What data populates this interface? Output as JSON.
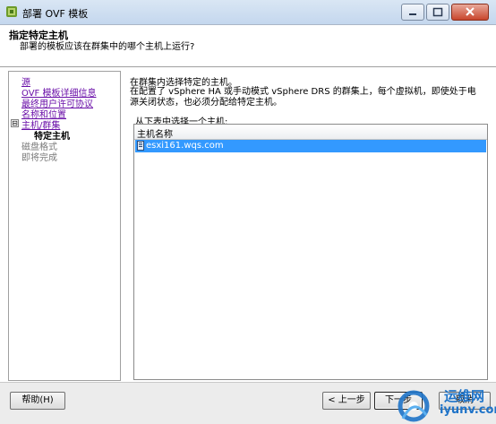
{
  "window": {
    "title": "部署 OVF 模板"
  },
  "header": {
    "title": "指定特定主机",
    "subtitle": "部署的模板应该在群集中的哪个主机上运行?"
  },
  "nav": {
    "items": [
      {
        "label": "源",
        "state": "link"
      },
      {
        "label": "OVF 模板详细信息",
        "state": "link"
      },
      {
        "label": "最终用户许可协议",
        "state": "link"
      },
      {
        "label": "名称和位置",
        "state": "link"
      },
      {
        "label": "主机/群集",
        "state": "link"
      },
      {
        "label": "特定主机",
        "state": "current"
      },
      {
        "label": "磁盘格式",
        "state": "disabled"
      },
      {
        "label": "即将完成",
        "state": "disabled"
      }
    ],
    "tree_toggle": "⊟"
  },
  "content": {
    "intro": "在群集内选择特定的主机。",
    "description": "在配置了 vSphere HA 或手动模式 vSphere DRS 的群集上，每个虚拟机，即使处于电源关闭状态，也必须分配给特定主机。",
    "list_label": "从下表中选择一个主机:",
    "table": {
      "column": "主机名称",
      "rows": [
        {
          "name": "esxi161.wqs.com",
          "selected": true
        }
      ]
    }
  },
  "footer": {
    "help": "帮助(H)",
    "back": "< 上一步",
    "next": "下一步",
    "cancel": "取消"
  },
  "watermark": {
    "line1": "运维网",
    "line2": "iyunv.com"
  },
  "colors": {
    "selection": "#3399ff",
    "link": "#6a0fa8",
    "brand": "#1e73c8"
  }
}
